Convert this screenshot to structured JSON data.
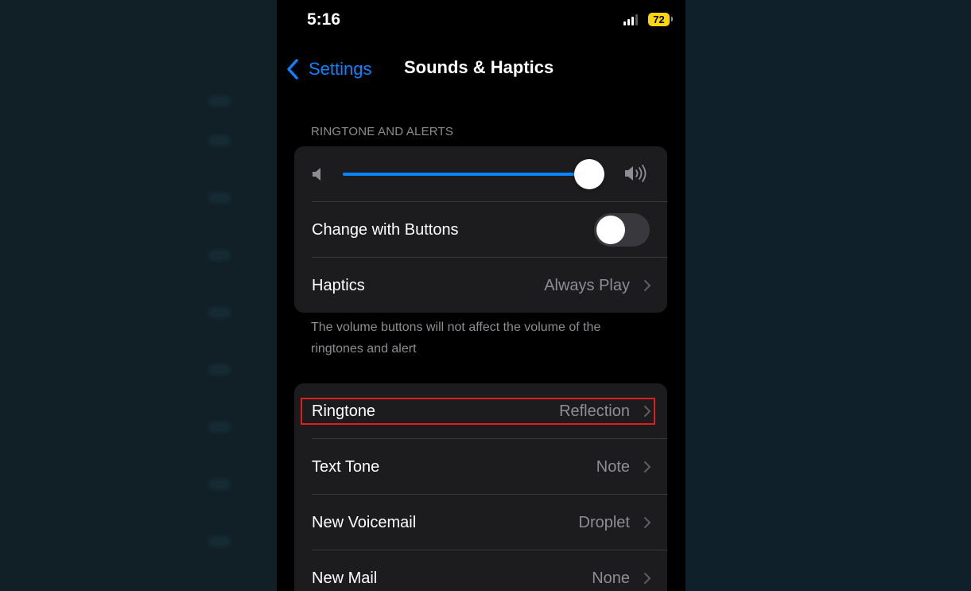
{
  "status_bar": {
    "time": "5:16",
    "battery_level": "72"
  },
  "nav": {
    "back_label": "Settings",
    "title": "Sounds & Haptics"
  },
  "ringtone_section": {
    "header": "RINGTONE AND ALERTS",
    "volume_level": 0.99,
    "change_with_buttons": {
      "label": "Change with Buttons",
      "enabled": false
    },
    "haptics": {
      "label": "Haptics",
      "value": "Always Play"
    },
    "footer": "The volume buttons will not affect the volume of the ringtones and alert"
  },
  "sounds": [
    {
      "label": "Ringtone",
      "value": "Reflection"
    },
    {
      "label": "Text Tone",
      "value": "Note"
    },
    {
      "label": "New Voicemail",
      "value": "Droplet"
    },
    {
      "label": "New Mail",
      "value": "None"
    }
  ],
  "colors": {
    "accent": "#0a84ff",
    "highlight": "#e01e1e",
    "battery": "#ffd60a"
  }
}
